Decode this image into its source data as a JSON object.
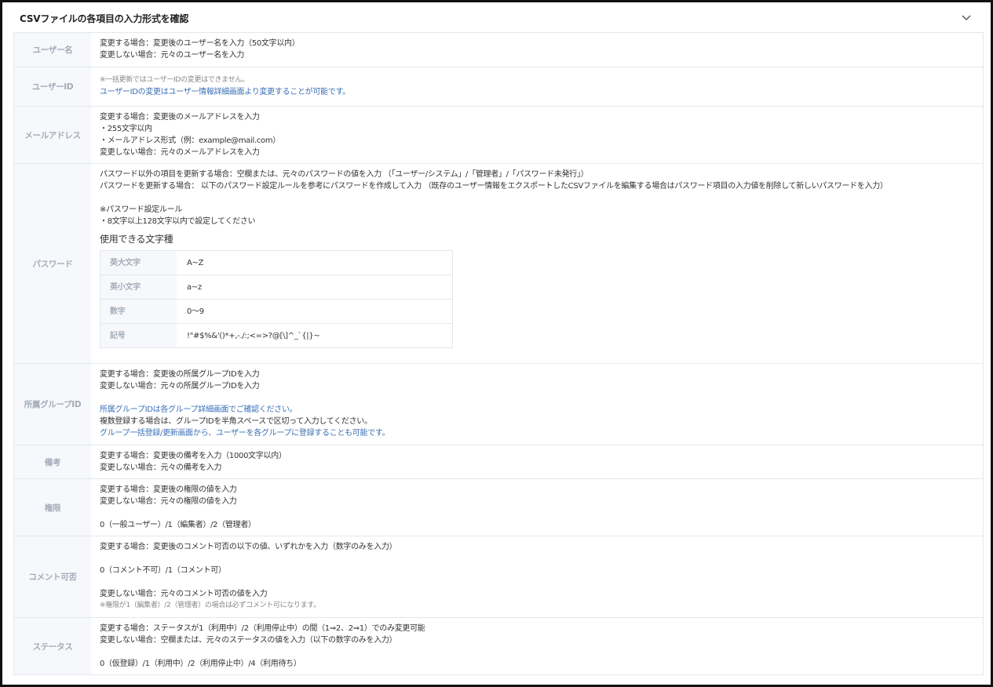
{
  "panel": {
    "title": "CSVファイルの各項目の入力形式を確認"
  },
  "rows": {
    "username": {
      "label": "ユーザー名",
      "lines": [
        "変更する場合：変更後のユーザー名を入力（50文字以内）",
        "変更しない場合：元々のユーザー名を入力"
      ]
    },
    "userid": {
      "label": "ユーザーID",
      "note": "※一括更新ではユーザーIDの変更はできません。",
      "link": "ユーザーIDの変更はユーザー情報詳細画面より変更することが可能です。"
    },
    "email": {
      "label": "メールアドレス",
      "lines": [
        "変更する場合：変更後のメールアドレスを入力",
        "・255文字以内",
        "・メールアドレス形式（例：example@mail.com）",
        "変更しない場合：元々のメールアドレスを入力"
      ]
    },
    "password": {
      "label": "パスワード",
      "lines": [
        "パスワード以外の項目を更新する場合：空欄または、元々のパスワードの値を入力 （「ユーザー/システム」/「管理者」/「パスワード未発行」）",
        "パスワードを更新する場合： 以下のパスワード設定ルールを参考にパスワードを作成して入力 （既存のユーザー情報をエクスポートしたCSVファイルを編集する場合はパスワード項目の入力値を削除して新しいパスワードを入力）",
        "",
        "※パスワード設定ルール",
        "・8文字以上128文字以内で設定してください"
      ],
      "charset_heading": "使用できる文字種",
      "charset": [
        {
          "label": "英大文字",
          "value": "A~Z"
        },
        {
          "label": "英小文字",
          "value": "a~z"
        },
        {
          "label": "数字",
          "value": "0〜9"
        },
        {
          "label": "記号",
          "value": "!\"#$%&'()*+,-./:;<=>?@[\\]^_`{|}~"
        }
      ]
    },
    "group": {
      "label": "所属グループID",
      "lines": [
        "変更する場合：変更後の所属グループIDを入力",
        "変更しない場合：元々の所属グループIDを入力",
        ""
      ],
      "link1": "所属グループIDは各グループ詳細画面でご確認ください。",
      "line2": "複数登録する場合は、グループIDを半角スペースで区切って入力してください。",
      "link2": "グループ一括登録/更新画面から、ユーザーを各グループに登録することも可能です。"
    },
    "remarks": {
      "label": "備考",
      "lines": [
        "変更する場合：変更後の備考を入力（1000文字以内）",
        "変更しない場合：元々の備考を入力"
      ]
    },
    "permission": {
      "label": "権限",
      "lines": [
        "変更する場合：変更後の権限の値を入力",
        "変更しない場合：元々の権限の値を入力",
        "",
        "0（一般ユーザー）/1（編集者）/2（管理者）"
      ]
    },
    "comment": {
      "label": "コメント可否",
      "lines": [
        "変更する場合：変更後のコメント可否の以下の値、いずれかを入力（数字のみを入力）",
        "",
        "0（コメント不可）/1（コメント可）",
        "",
        "変更しない場合：元々のコメント可否の値を入力"
      ],
      "note": "※権限が1（編集者）/2（管理者）の場合は必ずコメント可になります。"
    },
    "status": {
      "label": "ステータス",
      "lines": [
        "変更する場合：ステータスが1（利用中）/2（利用停止中）の間（1⇒2、2⇒1）でのみ変更可能",
        "変更しない場合：空欄または、元々のステータスの値を入力（以下の数字のみを入力）",
        "",
        "0（仮登録）/1（利用中）/2（利用停止中）/4（利用待ち）"
      ]
    }
  },
  "icons": {
    "collapse": "chevron-down-icon"
  }
}
